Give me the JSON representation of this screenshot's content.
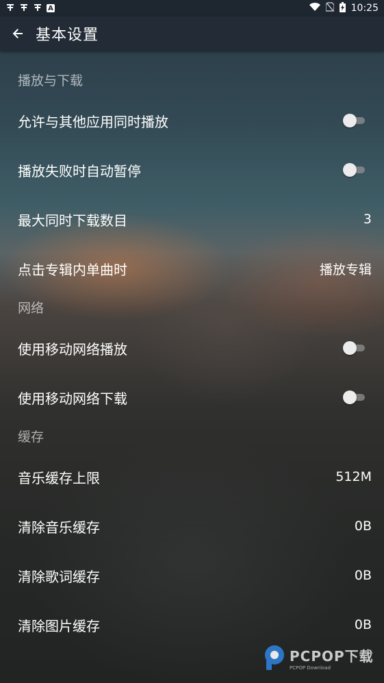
{
  "status_bar": {
    "left_icons": [
      "bug-icon",
      "bug-icon",
      "bug-icon",
      "a-notification-icon"
    ],
    "time": "10:25"
  },
  "app_bar": {
    "title": "基本设置"
  },
  "sections": [
    {
      "header": "播放与下载",
      "rows": [
        {
          "label": "允许与其他应用同时播放",
          "type": "toggle",
          "on": false
        },
        {
          "label": "播放失败时自动暂停",
          "type": "toggle",
          "on": false
        },
        {
          "label": "最大同时下载数目",
          "type": "value",
          "value": "3"
        },
        {
          "label": "点击专辑内单曲时",
          "type": "value",
          "value": "播放专辑"
        }
      ]
    },
    {
      "header": "网络",
      "rows": [
        {
          "label": "使用移动网络播放",
          "type": "toggle",
          "on": false
        },
        {
          "label": "使用移动网络下载",
          "type": "toggle",
          "on": false
        }
      ]
    },
    {
      "header": "缓存",
      "rows": [
        {
          "label": "音乐缓存上限",
          "type": "value",
          "value": "512M"
        },
        {
          "label": "清除音乐缓存",
          "type": "value",
          "value": "0B"
        },
        {
          "label": "清除歌词缓存",
          "type": "value",
          "value": "0B"
        },
        {
          "label": "清除图片缓存",
          "type": "value",
          "value": "0B"
        }
      ]
    }
  ],
  "watermark": {
    "brand": "PCPOP下载",
    "sub": "PCPOP Download"
  }
}
